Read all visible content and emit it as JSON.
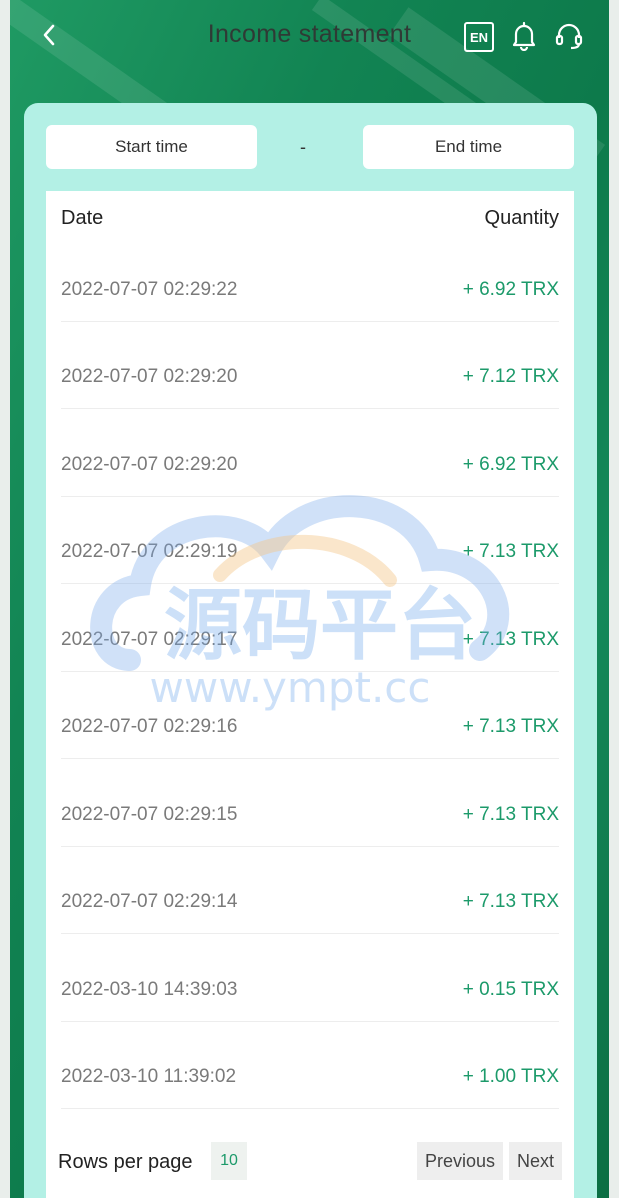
{
  "header": {
    "title": "Income statement",
    "lang_badge": "EN"
  },
  "filters": {
    "start_label": "Start time",
    "separator": "-",
    "end_label": "End time"
  },
  "table": {
    "col_date": "Date",
    "col_quantity": "Quantity",
    "rows": [
      {
        "date": "2022-07-07 02:29:22",
        "amount": "+ 6.92 TRX"
      },
      {
        "date": "2022-07-07 02:29:20",
        "amount": "+ 7.12 TRX"
      },
      {
        "date": "2022-07-07 02:29:20",
        "amount": "+ 6.92 TRX"
      },
      {
        "date": "2022-07-07 02:29:19",
        "amount": "+ 7.13 TRX"
      },
      {
        "date": "2022-07-07 02:29:17",
        "amount": "+ 7.13 TRX"
      },
      {
        "date": "2022-07-07 02:29:16",
        "amount": "+ 7.13 TRX"
      },
      {
        "date": "2022-07-07 02:29:15",
        "amount": "+ 7.13 TRX"
      },
      {
        "date": "2022-07-07 02:29:14",
        "amount": "+ 7.13 TRX"
      },
      {
        "date": "2022-03-10 14:39:03",
        "amount": "+ 0.15 TRX"
      },
      {
        "date": "2022-03-10 11:39:02",
        "amount": "+ 1.00 TRX"
      }
    ]
  },
  "pagination": {
    "rows_per_page_label": "Rows per page",
    "rows_per_page_value": "10",
    "previous_label": "Previous",
    "next_label": "Next"
  },
  "watermark": {
    "brand_text": "源码平台",
    "url_text": "www.ympt.cc"
  },
  "colors": {
    "header_green": "#128453",
    "card_mint": "#b3f0e5",
    "amount_green": "#1c9a6a"
  },
  "icons": [
    "back-arrow-icon",
    "bell-icon",
    "headset-icon"
  ]
}
